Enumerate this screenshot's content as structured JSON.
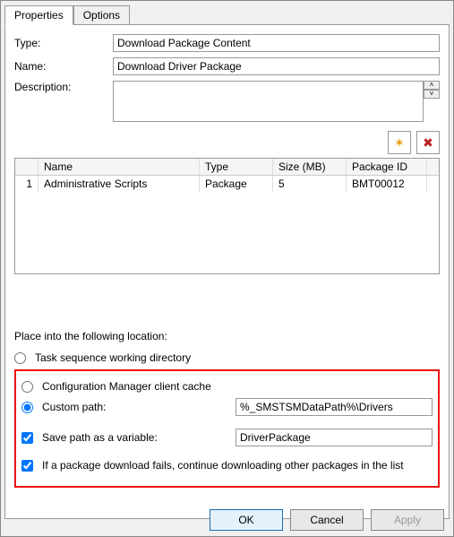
{
  "tabs": {
    "properties": "Properties",
    "options": "Options"
  },
  "labels": {
    "type": "Type:",
    "name": "Name:",
    "description": "Description:",
    "placeInto": "Place into the following location:"
  },
  "fields": {
    "type": "Download Package Content",
    "name": "Download Driver Package",
    "description": ""
  },
  "grid": {
    "headers": {
      "idx": "",
      "name": "Name",
      "type": "Type",
      "size": "Size (MB)",
      "pkg": "Package ID"
    },
    "rows": [
      {
        "idx": "1",
        "name": "Administrative Scripts",
        "type": "Package",
        "size": "5",
        "pkg": "BMT00012"
      }
    ]
  },
  "location": {
    "workingDir": "Task sequence working directory",
    "clientCache": "Configuration Manager client cache",
    "customPath": "Custom path:",
    "customPathValue": "%_SMSTSMDataPath%\\Drivers",
    "savePathVar": "Save path as a variable:",
    "savePathVarValue": "DriverPackage",
    "continueOnFail": "If a package download fails, continue downloading other packages in the list"
  },
  "buttons": {
    "ok": "OK",
    "cancel": "Cancel",
    "apply": "Apply"
  },
  "icons": {
    "new": "✶",
    "delete": "✖"
  }
}
